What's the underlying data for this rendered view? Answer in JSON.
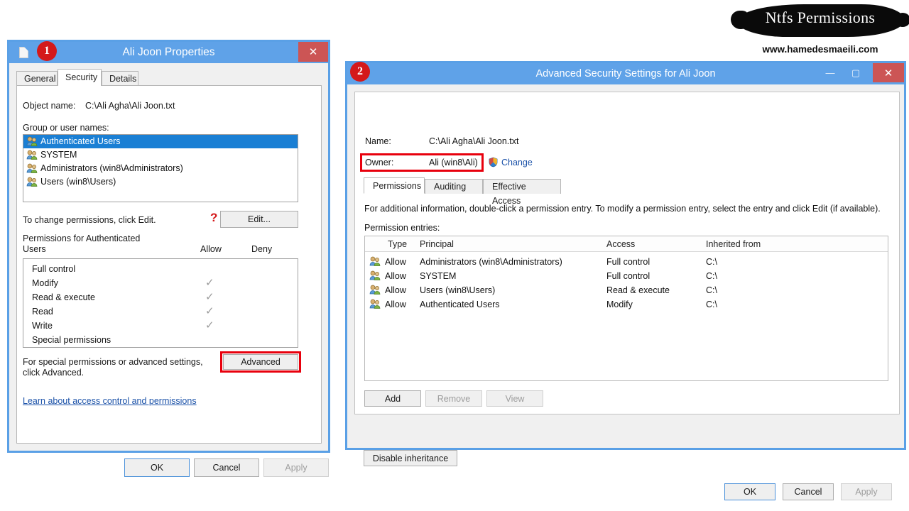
{
  "watermark": {
    "title": "Ntfs Permissions",
    "url": "www.hamedesmaeili.com"
  },
  "dialog1": {
    "badge": "1",
    "title": "Ali Joon Properties",
    "close_label": "✕",
    "tabs": [
      {
        "label": "General",
        "active": false
      },
      {
        "label": "Security",
        "active": true
      },
      {
        "label": "Details",
        "active": false
      }
    ],
    "object_name_label": "Object name:",
    "object_name_value": "C:\\Ali Agha\\Ali Joon.txt",
    "group_label": "Group or user names:",
    "users": [
      {
        "name": "Authenticated Users",
        "selected": true
      },
      {
        "name": "SYSTEM",
        "selected": false
      },
      {
        "name": "Administrators (win8\\Administrators)",
        "selected": false
      },
      {
        "name": "Users (win8\\Users)",
        "selected": false
      }
    ],
    "edit_hint": "To change permissions, click Edit.",
    "question_mark": "?",
    "edit_button": "Edit...",
    "perm_header_line1": "Permissions for Authenticated",
    "perm_header_line2": "Users",
    "col_allow": "Allow",
    "col_deny": "Deny",
    "permissions": [
      {
        "name": "Full control",
        "allow": false,
        "deny": false
      },
      {
        "name": "Modify",
        "allow": true,
        "deny": false
      },
      {
        "name": "Read & execute",
        "allow": true,
        "deny": false
      },
      {
        "name": "Read",
        "allow": true,
        "deny": false
      },
      {
        "name": "Write",
        "allow": true,
        "deny": false
      },
      {
        "name": "Special permissions",
        "allow": false,
        "deny": false
      }
    ],
    "check_glyph": "✓",
    "advanced_hint_line1": "For special permissions or advanced settings,",
    "advanced_hint_line2": "click Advanced.",
    "advanced_button": "Advanced",
    "learn_link": "Learn about access control and permissions",
    "ok_button": "OK",
    "cancel_button": "Cancel",
    "apply_button": "Apply"
  },
  "dialog2": {
    "badge": "2",
    "title": "Advanced Security Settings for Ali Joon",
    "minimize_label": "—",
    "maximize_label": "▢",
    "close_label": "✕",
    "name_label": "Name:",
    "name_value": "C:\\Ali Agha\\Ali Joon.txt",
    "owner_label": "Owner:",
    "owner_value": "Ali (win8\\Ali)",
    "change_link": "Change",
    "tabs": [
      {
        "label": "Permissions",
        "active": true
      },
      {
        "label": "Auditing",
        "active": false
      },
      {
        "label": "Effective Access",
        "active": false
      }
    ],
    "info_text": "For additional information, double-click a permission entry. To modify a permission entry, select the entry and click Edit (if available).",
    "entries_label": "Permission entries:",
    "columns": [
      "Type",
      "Principal",
      "Access",
      "Inherited from"
    ],
    "rows": [
      {
        "type": "Allow",
        "principal": "Administrators (win8\\Administrators)",
        "access": "Full control",
        "inherited": "C:\\"
      },
      {
        "type": "Allow",
        "principal": "SYSTEM",
        "access": "Full control",
        "inherited": "C:\\"
      },
      {
        "type": "Allow",
        "principal": "Users (win8\\Users)",
        "access": "Read & execute",
        "inherited": "C:\\"
      },
      {
        "type": "Allow",
        "principal": "Authenticated Users",
        "access": "Modify",
        "inherited": "C:\\"
      }
    ],
    "add_button": "Add",
    "remove_button": "Remove",
    "view_button": "View",
    "disable_inheritance_button": "Disable inheritance",
    "ok_button": "OK",
    "cancel_button": "Cancel",
    "apply_button": "Apply"
  },
  "colors": {
    "window_border": "#5aa0e6",
    "titlebar": "#5fa2e8",
    "close_red": "#cc5555",
    "annotation_red": "#e8000d",
    "badge_red": "#d4191b",
    "selection_blue": "#1a7fd4",
    "link_blue": "#1a51a8"
  }
}
